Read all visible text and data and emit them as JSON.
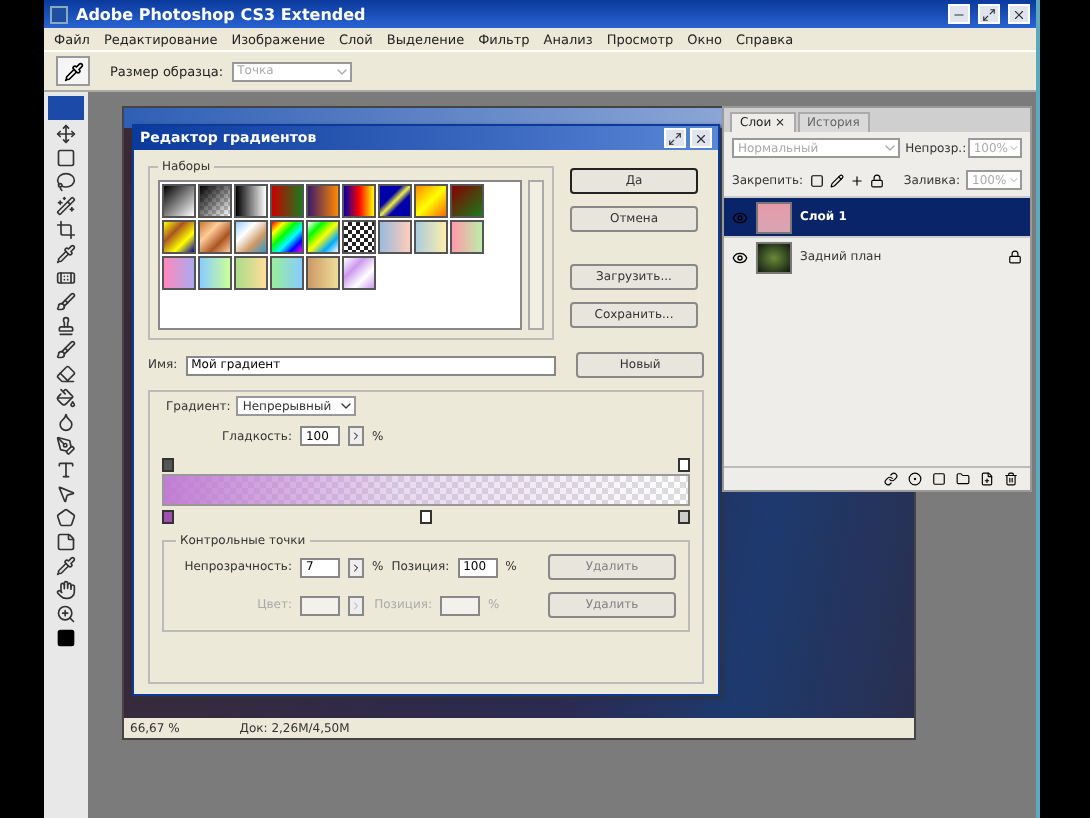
{
  "window": {
    "title": "Adobe Photoshop CS3 Extended"
  },
  "menu": [
    "Файл",
    "Редактирование",
    "Изображение",
    "Слой",
    "Выделение",
    "Фильтр",
    "Анализ",
    "Просмотр",
    "Окно",
    "Справка"
  ],
  "options_bar": {
    "label": "Размер образца:",
    "value": "Точка"
  },
  "status_bar": {
    "zoom": "66,67 %",
    "doc": "Док: 2,26M/4,50M"
  },
  "gradient_editor": {
    "title": "Редактор градиентов",
    "presets_label": "Наборы",
    "buttons": [
      {
        "label": "Да",
        "default": true
      },
      {
        "label": "Отмена",
        "default": false
      },
      {
        "label": "Загрузить...",
        "default": false
      },
      {
        "label": "Сохранить...",
        "default": false
      }
    ],
    "name_label": "Имя:",
    "name_value": "Мой градиент",
    "new_button": "Новый",
    "type_label": "Градиент:",
    "type_value": "Непрерывный",
    "smoothness_label": "Гладкость:",
    "smoothness_value": "100",
    "smoothness_unit": "%",
    "stops_label": "Контрольные точки",
    "stop_rows": [
      {
        "label": "Непрозрачность:",
        "value": "7",
        "unit": "%",
        "position_label": "Позиция:",
        "position_value": "100",
        "position_unit": "%",
        "delete": "Удалить",
        "disabled": false
      },
      {
        "label": "Цвет:",
        "value": "",
        "unit": "",
        "position_label": "Позиция:",
        "position_value": "",
        "position_unit": "%",
        "delete": "Удалить",
        "disabled": true
      }
    ]
  },
  "layers_panel": {
    "tabs": [
      {
        "label": "Слои ×",
        "selected": true
      },
      {
        "label": "История",
        "selected": false
      }
    ],
    "blend_mode": "Нормальный",
    "opacity_label": "Непрозр.:",
    "opacity_value": "100%",
    "lock_label": "Закрепить:",
    "fill_label": "Заливка:",
    "fill_value": "100%",
    "layers": [
      {
        "name": "Слой 1",
        "selected": true,
        "locked": false,
        "kind": "pink"
      },
      {
        "name": "Задний план",
        "selected": false,
        "locked": true,
        "kind": "photo"
      }
    ]
  }
}
